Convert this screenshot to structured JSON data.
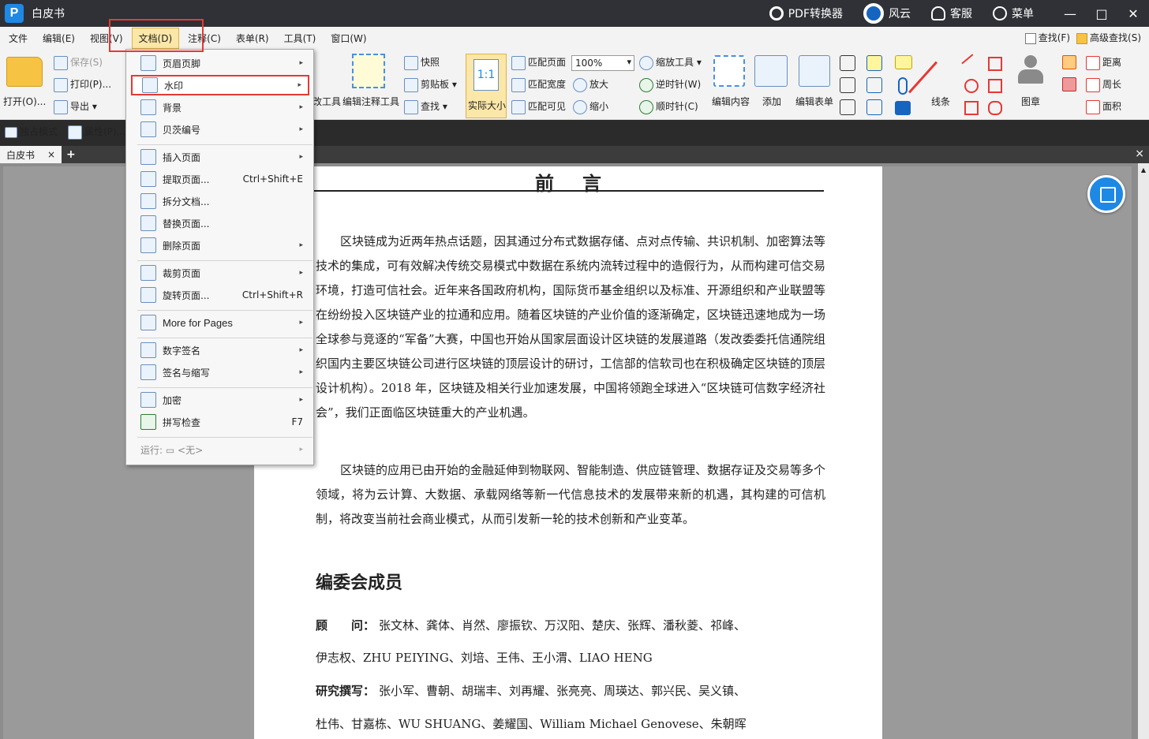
{
  "titlebar": {
    "app_title": "白皮书",
    "pdf_converter": "PDF转换器",
    "fengyun": "风云",
    "support": "客服",
    "menu": "菜单",
    "minimize": "—",
    "maximize": "□",
    "close": "✕"
  },
  "menubar": {
    "items": [
      "文件",
      "编辑(E)",
      "视图(V)",
      "文档(D)",
      "注释(C)",
      "表单(R)",
      "工具(T)",
      "窗口(W)"
    ],
    "find": "查找(F)",
    "advanced_find": "高级查找(S)"
  },
  "ribbon": {
    "open": "打开(O)...",
    "save": "保存(S)",
    "print": "打印(P)...",
    "export": "导出",
    "exclusive_mode": "独占模式",
    "properties": "属性(P)...",
    "tool_partial": "改工具",
    "edit_annotation_tool": "编辑注释工具",
    "snapshot": "快照",
    "clipboard": "剪贴板",
    "find": "查找",
    "actual_size": "实际大小",
    "actual_size_glyph": "1:1",
    "fit_page": "匹配页面",
    "fit_width": "匹配宽度",
    "fit_visible": "匹配可见",
    "zoom_value": "100%",
    "zoom_in": "放大",
    "zoom_out": "缩小",
    "zoom_tool": "缩放工具",
    "rotate_ccw": "逆时针(W)",
    "rotate_cw": "顺时针(C)",
    "edit_content": "编辑内容",
    "add": "添加",
    "edit_form": "编辑表单",
    "lines": "线条",
    "stamp": "图章",
    "distance": "距离",
    "perimeter": "周长",
    "area": "面积"
  },
  "tabs": {
    "doc_tab": "白皮书",
    "close": "×",
    "add": "+",
    "close_all": "×"
  },
  "dropdown": {
    "items": [
      {
        "label": "页眉页脚",
        "shortcut": "",
        "arrow": "▸"
      },
      {
        "label": "水印",
        "shortcut": "",
        "arrow": "▸"
      },
      {
        "label": "背景",
        "shortcut": "",
        "arrow": "▸"
      },
      {
        "label": "贝茨编号",
        "shortcut": "",
        "arrow": "▸"
      },
      {
        "label": "插入页面",
        "shortcut": "",
        "arrow": "▸"
      },
      {
        "label": "提取页面...",
        "shortcut": "Ctrl+Shift+E",
        "arrow": ""
      },
      {
        "label": "拆分文档...",
        "shortcut": "",
        "arrow": ""
      },
      {
        "label": "替换页面...",
        "shortcut": "",
        "arrow": ""
      },
      {
        "label": "删除页面",
        "shortcut": "",
        "arrow": "▸"
      },
      {
        "label": "裁剪页面",
        "shortcut": "",
        "arrow": "▸"
      },
      {
        "label": "旋转页面...",
        "shortcut": "Ctrl+Shift+R",
        "arrow": ""
      },
      {
        "label": "More for Pages",
        "shortcut": "",
        "arrow": "▸"
      },
      {
        "label": "数字签名",
        "shortcut": "",
        "arrow": "▸"
      },
      {
        "label": "签名与缩写",
        "shortcut": "",
        "arrow": "▸"
      },
      {
        "label": "加密",
        "shortcut": "",
        "arrow": "▸"
      },
      {
        "label": "拼写检查",
        "shortcut": "F7",
        "arrow": ""
      },
      {
        "label": "运行: ▭ <无>",
        "shortcut": "",
        "arrow": "▸"
      }
    ]
  },
  "document": {
    "heading": "前言",
    "para1": "区块链成为近两年热点话题，因其通过分布式数据存储、点对点传输、共识机制、加密算法等技术的集成，可有效解决传统交易模式中数据在系统内流转过程中的造假行为，从而构建可信交易环境，打造可信社会。近年来各国政府机构，国际货币基金组织以及标准、开源组织和产业联盟等在纷纷投入区块链产业的拉通和应用。随着区块链的产业价值的逐渐确定，区块链迅速地成为一场全球参与竞逐的“军备”大赛，中国也开始从国家层面设计区块链的发展道路（发改委委托信通院组织国内主要区块链公司进行区块链的顶层设计的研讨，工信部的信软司也在积极确定区块链的顶层设计机构）。2018 年，区块链及相关行业加速发展，中国将领跑全球进入“区块链可信数字经济社会”，我们正面临区块链重大的产业机遇。",
    "para2": "区块链的应用已由开始的金融延伸到物联网、智能制造、供应链管理、数据存证及交易等多个领域，将为云计算、大数据、承载网络等新一代信息技术的发展带来新的机遇，其构建的可信机制，将改变当前社会商业模式，从而引发新一轮的技术创新和产业变革。",
    "section_title": "编委会成员",
    "advisor_label": "顾　　问：",
    "advisor_line1": "张文林、龚体、肖然、廖振钦、万汉阳、楚庆、张辉、潘秋菱、祁峰、",
    "advisor_line2": "伊志权、ZHU PEIYING、刘培、王伟、王小渭、LIAO HENG",
    "writer_label": "研究撰写：",
    "writer_line1": "张小军、曹朝、胡瑞丰、刘再耀、张亮亮、周瑛达、郭兴民、吴义镇、",
    "writer_line2": "杜伟、甘嘉栋、WU SHUANG、姜耀国、William Michael Genovese、朱朝晖"
  }
}
